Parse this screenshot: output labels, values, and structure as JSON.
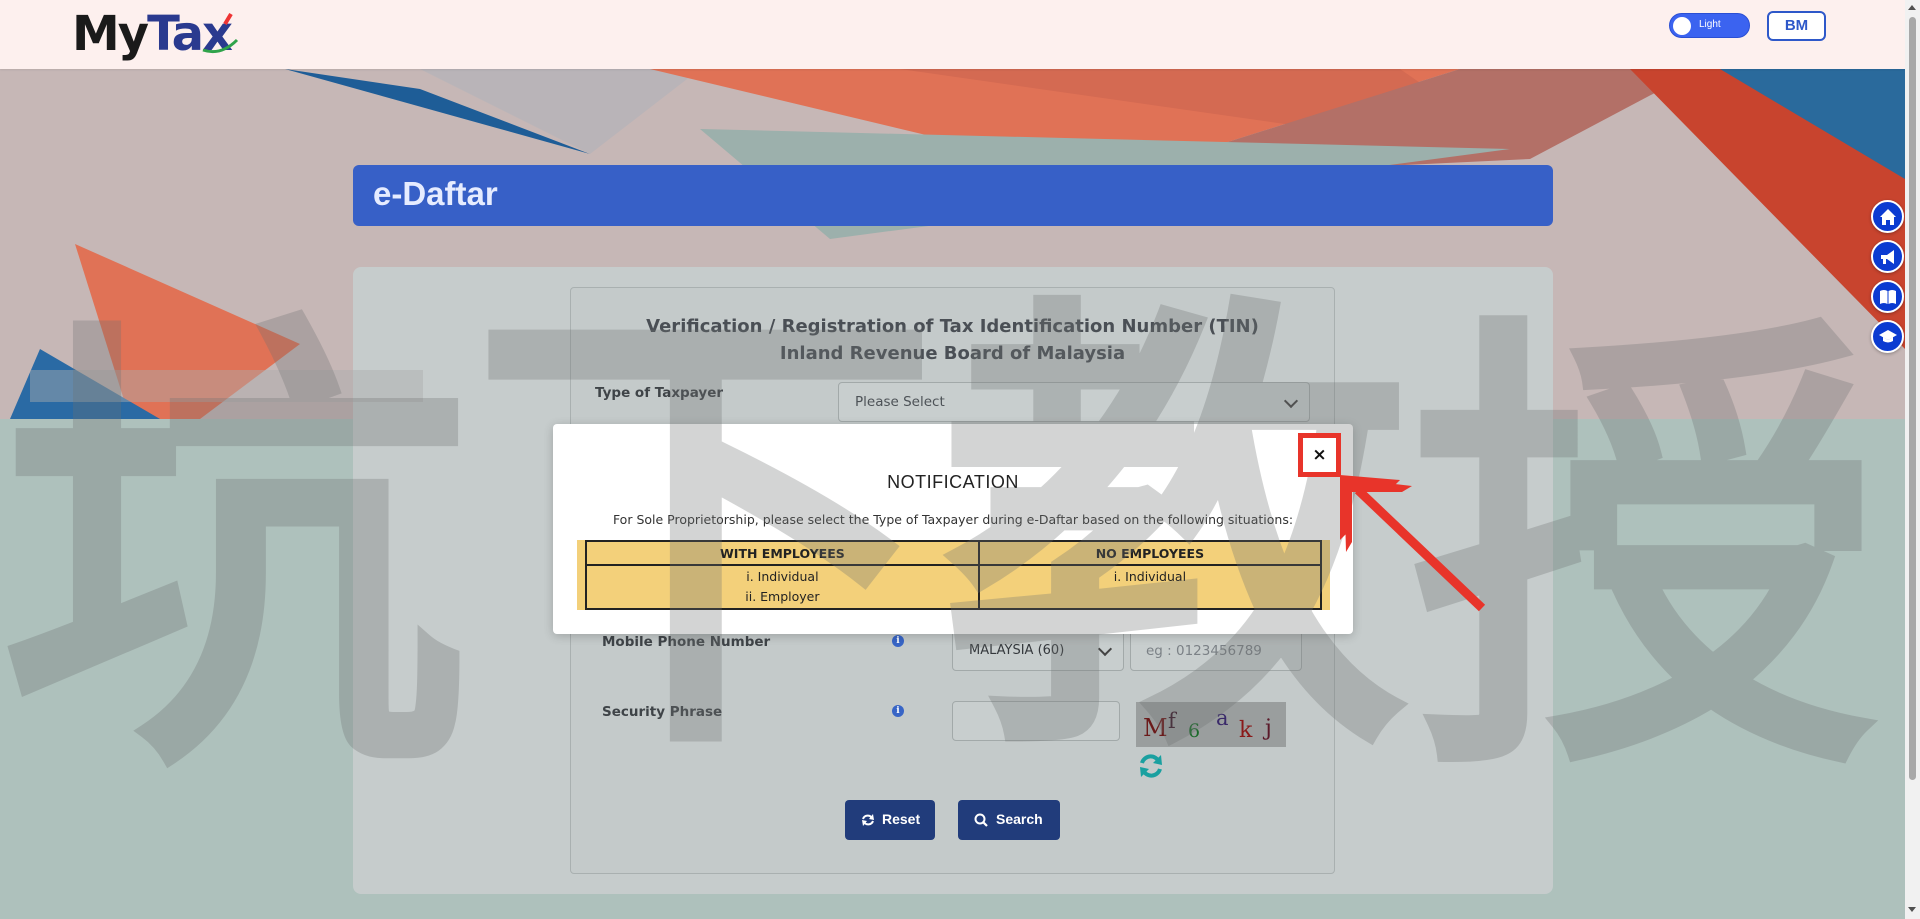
{
  "header": {
    "logo_my": "My",
    "logo_tax": "Tax",
    "theme_label": "Light",
    "lang_label": "BM"
  },
  "page": {
    "title": "e-Daftar"
  },
  "form": {
    "title_line1": "Verification / Registration of Tax Identification Number (TIN)",
    "title_line2": "Inland Revenue Board of Malaysia",
    "taxpayer_label": "Type of Taxpayer",
    "taxpayer_value": "Please Select",
    "mobile_label": "Mobile Phone Number",
    "country_value": "MALAYSIA (60)",
    "phone_placeholder": "eg : 0123456789",
    "phrase_label": "Security Phrase",
    "captcha_chars": [
      "M",
      "f",
      "6",
      "a",
      "k",
      "j"
    ],
    "reset_label": "Reset",
    "search_label": "Search"
  },
  "modal": {
    "title": "NOTIFICATION",
    "description": "For Sole Proprietorship, please select the Type of Taxpayer during e-Daftar based on the following situations:",
    "col1_header": "WITH EMPLOYEES",
    "col2_header": "NO EMPLOYEES",
    "col1_line1": "i. Individual",
    "col1_line2": "ii. Employer",
    "col2_line1": "i. Individual",
    "close_symbol": "×"
  },
  "watermark": {
    "chars": [
      "坑",
      "下",
      "教",
      "授"
    ]
  },
  "colors": {
    "primary_blue": "#3760c7",
    "button_navy": "#213c7b",
    "annotation_red": "#e8342a",
    "table_yellow": "#f3d07a",
    "side_button_blue": "#0b3bd1"
  },
  "side_icons": [
    "home-icon",
    "megaphone-icon",
    "book-icon",
    "graduation-cap-icon"
  ]
}
